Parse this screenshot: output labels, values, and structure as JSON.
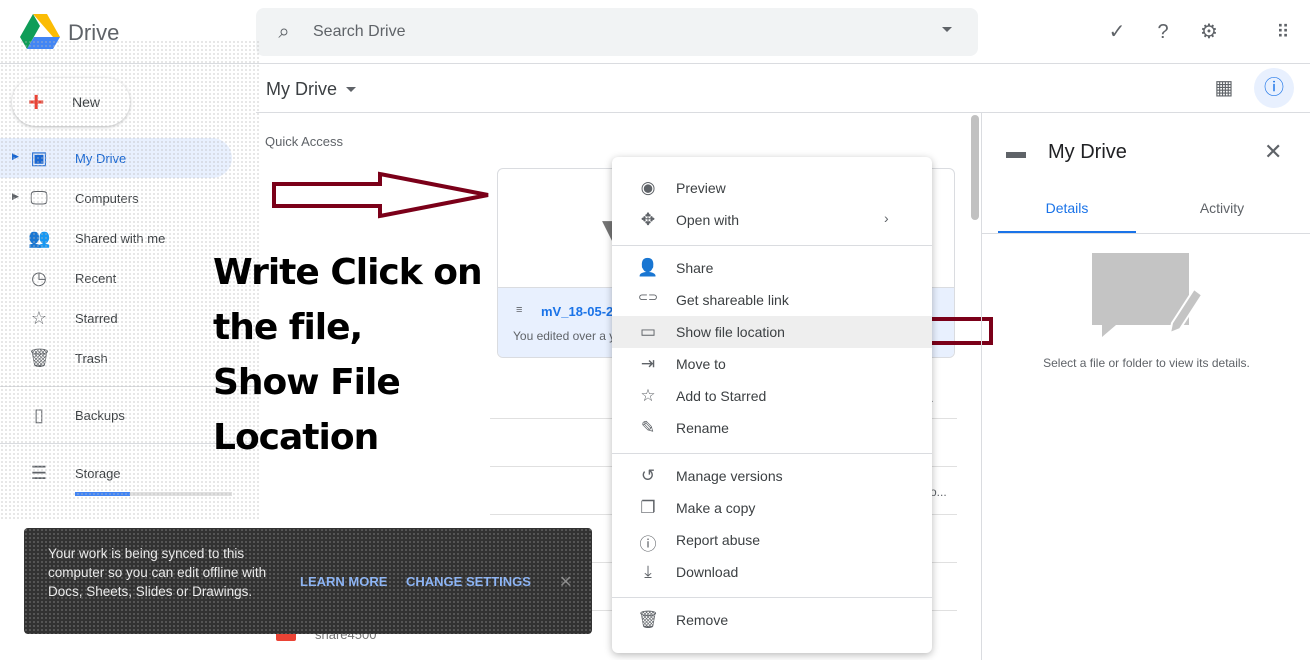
{
  "app": {
    "brand": "Drive",
    "search_placeholder": "Search Drive"
  },
  "toolbar_icons": [
    "offline-check-icon",
    "help-icon",
    "settings-icon",
    "apps-grid-icon"
  ],
  "new_button": "New",
  "sidebar": {
    "items": [
      {
        "label": "My Drive",
        "icon": "my-drive-icon",
        "active": true
      },
      {
        "label": "Computers",
        "icon": "computers-icon"
      },
      {
        "label": "Shared with me",
        "icon": "shared-icon"
      },
      {
        "label": "Recent",
        "icon": "clock-icon"
      },
      {
        "label": "Starred",
        "icon": "star-icon"
      },
      {
        "label": "Trash",
        "icon": "trash-icon"
      },
      {
        "label": "Backups",
        "icon": "backups-icon"
      },
      {
        "label": "Storage",
        "icon": "storage-icon"
      }
    ]
  },
  "header": {
    "title": "My Drive"
  },
  "quick_access": {
    "label": "Quick Access",
    "file_name": "mV_18-05-2",
    "file_sub": "You edited over a y"
  },
  "files": {
    "last_name": "share4500",
    "truncated": "o..."
  },
  "context_menu": {
    "items": [
      {
        "label": "Preview",
        "icon": "eye-icon",
        "glyph": "◉"
      },
      {
        "label": "Open with",
        "icon": "move-arrows-icon",
        "glyph": "✥",
        "submenu": true
      },
      {
        "label": "Share",
        "icon": "person-add-icon",
        "glyph": "👤"
      },
      {
        "label": "Get shareable link",
        "icon": "link-icon",
        "glyph": "⊂⊃"
      },
      {
        "label": "Show file location",
        "icon": "folder-icon",
        "glyph": "▭",
        "highlighted": true
      },
      {
        "label": "Move to",
        "icon": "move-to-folder-icon",
        "glyph": "⇥"
      },
      {
        "label": "Add to Starred",
        "icon": "star-icon",
        "glyph": "☆"
      },
      {
        "label": "Rename",
        "icon": "pencil-icon",
        "glyph": "✎"
      },
      {
        "label": "Manage versions",
        "icon": "history-icon",
        "glyph": "↺"
      },
      {
        "label": "Make a copy",
        "icon": "copy-icon",
        "glyph": "❐"
      },
      {
        "label": "Report abuse",
        "icon": "alert-icon",
        "glyph": "ⓘ"
      },
      {
        "label": "Download",
        "icon": "download-icon",
        "glyph": "⤓"
      },
      {
        "label": "Remove",
        "icon": "trash-icon",
        "glyph": "🗑"
      }
    ]
  },
  "details_panel": {
    "title": "My Drive",
    "tabs": [
      "Details",
      "Activity"
    ],
    "empty_text": "Select a file or folder to view its details."
  },
  "toast": {
    "message": "Your work is being synced to this computer so you can edit offline with Docs, Sheets, Slides or Drawings.",
    "learn_more": "LEARN MORE",
    "change_settings": "CHANGE SETTINGS"
  },
  "annotation": {
    "lines": [
      "Write Click on",
      "the file,",
      "Show File",
      "Location"
    ],
    "arrow_color": "#7b0019"
  },
  "colors": {
    "accent": "#1a73e8",
    "active_bg": "#e8f0fe"
  }
}
